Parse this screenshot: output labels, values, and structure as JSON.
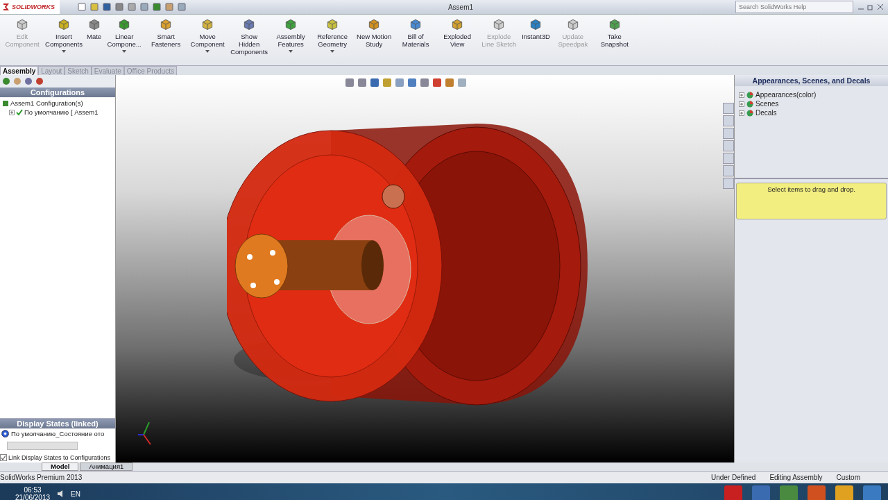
{
  "window": {
    "logo": "SOLIDWORKS",
    "title": "Assem1"
  },
  "search": {
    "placeholder": "Search SolidWorks Help"
  },
  "ribbon": [
    {
      "label": "Edit Component",
      "disabled": true,
      "dropdown": false
    },
    {
      "label": "Insert Components",
      "disabled": false,
      "dropdown": true
    },
    {
      "label": "Mate",
      "disabled": false,
      "dropdown": false
    },
    {
      "label": "Linear Compone...",
      "disabled": false,
      "dropdown": true
    },
    {
      "label": "Smart Fasteners",
      "disabled": false,
      "dropdown": false
    },
    {
      "label": "Move Component",
      "disabled": false,
      "dropdown": true
    },
    {
      "label": "Show Hidden Components",
      "disabled": false,
      "dropdown": false
    },
    {
      "label": "Assembly Features",
      "disabled": false,
      "dropdown": true
    },
    {
      "label": "Reference Geometry",
      "disabled": false,
      "dropdown": true
    },
    {
      "label": "New Motion Study",
      "disabled": false,
      "dropdown": false
    },
    {
      "label": "Bill of Materials",
      "disabled": false,
      "dropdown": false
    },
    {
      "label": "Exploded View",
      "disabled": false,
      "dropdown": false
    },
    {
      "label": "Explode Line Sketch",
      "disabled": true,
      "dropdown": false
    },
    {
      "label": "Instant3D",
      "disabled": false,
      "dropdown": false
    },
    {
      "label": "Update Speedpak",
      "disabled": true,
      "dropdown": false
    },
    {
      "label": "Take Snapshot",
      "disabled": false,
      "dropdown": false
    }
  ],
  "tabs": [
    {
      "label": "Assembly",
      "selected": true
    },
    {
      "label": "Layout",
      "selected": false
    },
    {
      "label": "Sketch",
      "selected": false
    },
    {
      "label": "Evaluate",
      "selected": false
    },
    {
      "label": "Office Products",
      "selected": false
    }
  ],
  "configurations": {
    "title": "Configurations",
    "tree": [
      {
        "label": "Assem1 Configuration(s)",
        "children": [
          {
            "label": "По умолчанию [ Assem1"
          }
        ]
      }
    ]
  },
  "display_states": {
    "title": "Display States (linked)",
    "items": [
      {
        "label": "По умолчанию_Состояние ото",
        "selected": true
      }
    ],
    "link_checkbox": {
      "label": "Link Display States to Configurations",
      "checked": true
    }
  },
  "bottom_tabs": [
    {
      "label": "Model",
      "selected": true
    },
    {
      "label": "Анимация1",
      "selected": false
    }
  ],
  "task_pane": {
    "title": "Appearances, Scenes, and Decals",
    "tree": [
      {
        "label": "Appearances(color)"
      },
      {
        "label": "Scenes"
      },
      {
        "label": "Decals"
      }
    ],
    "hint": "Select items to drag and drop."
  },
  "status_bar": {
    "product": "SolidWorks Premium 2013",
    "state": "Under Defined",
    "mode": "Editing Assembly",
    "units": "Custom"
  },
  "taskbar": {
    "time": "06:53",
    "date": "21/06/2013",
    "language": "EN"
  }
}
